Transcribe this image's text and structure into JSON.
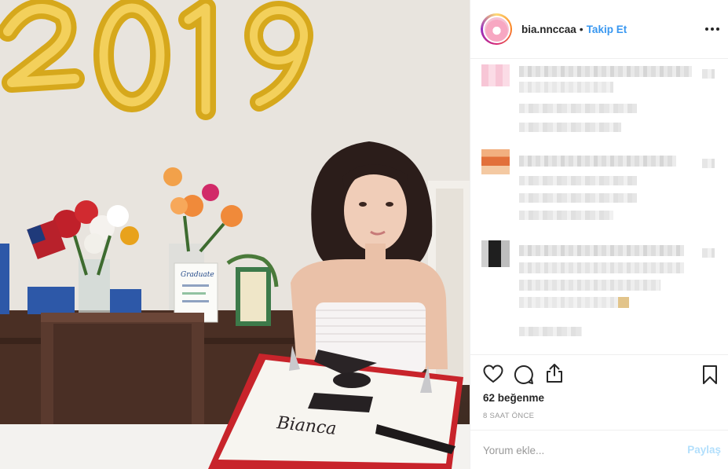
{
  "photo": {
    "balloon_text": "2019",
    "cake_text": "Bianca",
    "card_text": "Graduate"
  },
  "header": {
    "username": "bia.nnccaa",
    "separator": "•",
    "follow_label": "Takip Et",
    "more_icon": "more-horizontal-icon"
  },
  "actions": {
    "like_icon": "heart-icon",
    "comment_icon": "comment-bubble-icon",
    "share_icon": "share-icon",
    "save_icon": "bookmark-icon",
    "likes_text": "62 beğenme",
    "time_text": "8 SAAT ÖNCE"
  },
  "comment_form": {
    "placeholder": "Yorum ekle...",
    "submit_label": "Paylaş"
  },
  "colors": {
    "accent": "#3897f0",
    "submit_disabled": "#b2dffc",
    "muted": "#999999"
  }
}
